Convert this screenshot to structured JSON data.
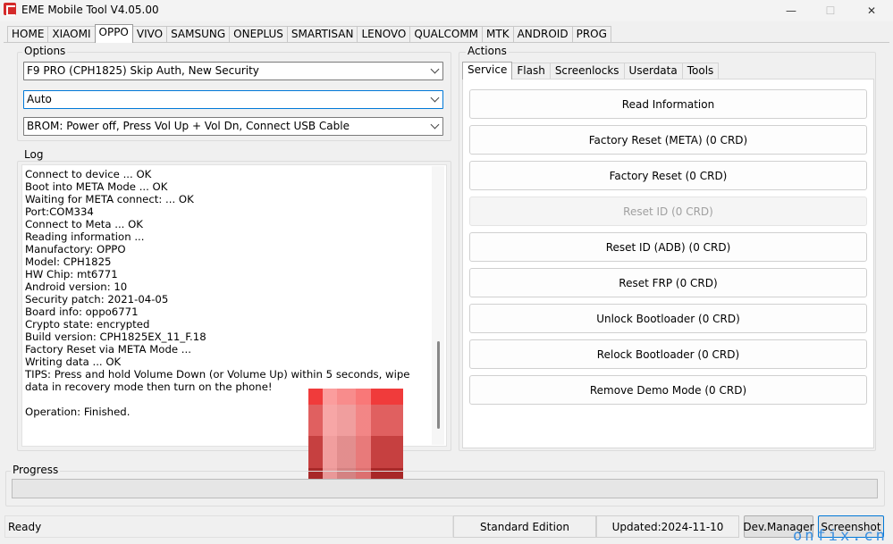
{
  "window": {
    "title": "EME Mobile Tool V4.05.00",
    "minimize_glyph": "—",
    "maximize_glyph": "☐",
    "close_glyph": "✕"
  },
  "tabs": [
    "HOME",
    "XIAOMI",
    "OPPO",
    "VIVO",
    "SAMSUNG",
    "ONEPLUS",
    "SMARTISAN",
    "LENOVO",
    "QUALCOMM",
    "MTK",
    "ANDROID",
    "PROG"
  ],
  "active_tab": "OPPO",
  "options": {
    "label": "Options",
    "model_value": "F9 PRO (CPH1825) Skip Auth, New Security",
    "mode_value": "Auto",
    "connect_value": "BROM: Power off, Press Vol Up + Vol Dn, Connect USB Cable"
  },
  "log": {
    "label": "Log",
    "text": "Connect to device ... OK\nBoot into META Mode ... OK\nWaiting for META connect: ... OK\nPort:COM334\nConnect to Meta ... OK\nReading information ...\nManufactory: OPPO\nModel: CPH1825\nHW Chip: mt6771\nAndroid version: 10\nSecurity patch: 2021-04-05\nBoard info: oppo6771\nCrypto state: encrypted\nBuild version: CPH1825EX_11_F.18\nFactory Reset via META Mode ...\nWriting data ... OK\nTIPS: Press and hold Volume Down (or Volume Up) within 5 seconds, wipe data in recovery mode then turn on the phone!\n\nOperation: Finished."
  },
  "actions": {
    "label": "Actions",
    "tabs": [
      "Service",
      "Flash",
      "Screenlocks",
      "Userdata",
      "Tools"
    ],
    "active_tab": "Service",
    "buttons": [
      {
        "label": "Read Information",
        "enabled": true
      },
      {
        "label": "Factory Reset (META) (0 CRD)",
        "enabled": true
      },
      {
        "label": "Factory Reset (0 CRD)",
        "enabled": true
      },
      {
        "label": "Reset ID (0 CRD)",
        "enabled": false
      },
      {
        "label": "Reset ID (ADB) (0 CRD)",
        "enabled": true
      },
      {
        "label": "Reset FRP (0 CRD)",
        "enabled": true
      },
      {
        "label": "Unlock Bootloader (0 CRD)",
        "enabled": true
      },
      {
        "label": "Relock Bootloader (0 CRD)",
        "enabled": true
      },
      {
        "label": "Remove Demo Mode (0 CRD)",
        "enabled": true
      }
    ]
  },
  "progress": {
    "label": "Progress",
    "value_percent": 0
  },
  "statusbar": {
    "status": "Ready",
    "edition": "Standard Edition",
    "updated": "Updated:2024-11-10",
    "dev_manager_label": "Dev.Manager",
    "screenshot_label": "Screenshot"
  },
  "watermark": "onfix.cn",
  "colors": {
    "accent": "#0078d7",
    "app_icon": "#d42a2a",
    "watermark": "#3a8fe0"
  }
}
